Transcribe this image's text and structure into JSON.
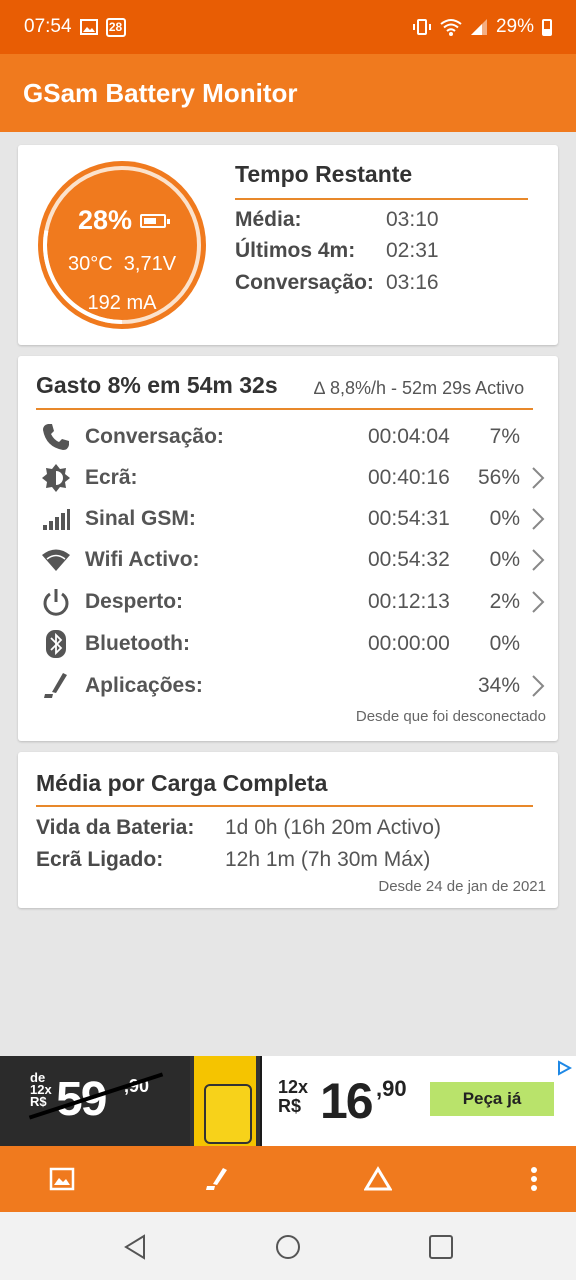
{
  "status_bar": {
    "time": "07:54",
    "calendar_day": "28",
    "battery_percent": "29%"
  },
  "app_bar": {
    "title": "GSam Battery Monitor"
  },
  "battery_gauge": {
    "percent": "28%",
    "level": 0.28,
    "temperature": "30°C",
    "voltage": "3,71V",
    "current": "192 mA"
  },
  "tempo_restante": {
    "title": "Tempo Restante",
    "rows": [
      {
        "label": "Média:",
        "value": "03:10"
      },
      {
        "label": "Últimos 4m:",
        "value": "02:31"
      },
      {
        "label": "Conversação:",
        "value": "03:16"
      }
    ]
  },
  "gasto": {
    "title": "Gasto 8% em 54m 32s",
    "subtitle": "∆ 8,8%/h - 52m 29s Activo",
    "rows": [
      {
        "icon": "phone-icon",
        "label": "Conversação:",
        "time": "00:04:04",
        "percent": "7%",
        "has_chevron": false
      },
      {
        "icon": "screen-brightness-icon",
        "label": "Ecrã:",
        "time": "00:40:16",
        "percent": "56%",
        "has_chevron": true
      },
      {
        "icon": "signal-bars-icon",
        "label": "Sinal GSM:",
        "time": "00:54:31",
        "percent": "0%",
        "has_chevron": true
      },
      {
        "icon": "wifi-icon",
        "label": "Wifi Activo:",
        "time": "00:54:32",
        "percent": "0%",
        "has_chevron": true
      },
      {
        "icon": "power-icon",
        "label": "Desperto:",
        "time": "00:12:13",
        "percent": "2%",
        "has_chevron": true
      },
      {
        "icon": "bluetooth-icon",
        "label": "Bluetooth:",
        "time": "00:00:00",
        "percent": "0%",
        "has_chevron": false
      },
      {
        "icon": "app-usage-icon",
        "label": "Aplicações:",
        "time": "",
        "percent": "34%",
        "has_chevron": true
      }
    ],
    "footer": "Desde que foi desconectado"
  },
  "media_carga": {
    "title": "Média por Carga Completa",
    "rows": [
      {
        "label": "Vida da Bateria:",
        "value": "1d 0h (16h 20m Activo)"
      },
      {
        "label": "Ecrã Ligado:",
        "value": "12h 1m (7h 30m Máx)"
      }
    ],
    "footer": "Desde 24 de jan de 2021"
  },
  "ad_banner": {
    "prefix": "de 12x R$",
    "old_price": "59",
    "old_cents": ",90",
    "installments": "12x",
    "currency": "R$",
    "new_price": "16",
    "new_cents": ",90",
    "cta": "Peça já"
  },
  "bottom_bar": {
    "icons": [
      "image-icon",
      "app-usage-icon",
      "delta-icon",
      "more-vert-icon"
    ]
  },
  "colors": {
    "status_bar": "#e85d04",
    "app_bar": "#f07a1e",
    "accent_line": "#e8882a",
    "gauge": "#f07a1e"
  }
}
